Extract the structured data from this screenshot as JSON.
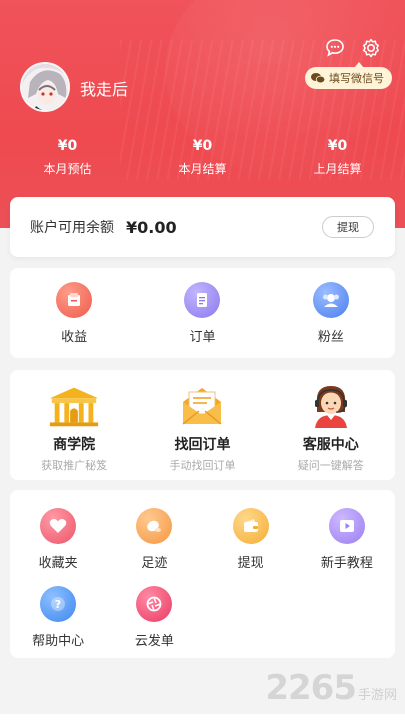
{
  "header": {
    "settings_chip": "填写微信号",
    "nickname": "我走后",
    "stats": [
      {
        "value": "¥0",
        "label": "本月预估"
      },
      {
        "value": "¥0",
        "label": "本月结算"
      },
      {
        "value": "¥0",
        "label": "上月结算"
      }
    ]
  },
  "balance": {
    "label": "账户可用余额",
    "amount": "¥0.00",
    "button": "提现"
  },
  "quick": [
    {
      "label": "收益",
      "icon": "income-icon",
      "color": "#f26b57"
    },
    {
      "label": "订单",
      "icon": "order-icon",
      "color": "#9a87f0"
    },
    {
      "label": "粉丝",
      "icon": "fans-icon",
      "color": "#5a8df5"
    }
  ],
  "features": [
    {
      "title": "商学院",
      "sub": "获取推广秘笈",
      "icon": "academy-icon"
    },
    {
      "title": "找回订单",
      "sub": "手动找回订单",
      "icon": "mail-icon"
    },
    {
      "title": "客服中心",
      "sub": "疑问一键解答",
      "icon": "support-agent-icon"
    }
  ],
  "tools": [
    {
      "label": "收藏夹",
      "icon": "heart-icon",
      "color": "#f06572"
    },
    {
      "label": "足迹",
      "icon": "footprint-icon",
      "color": "#f8a35a"
    },
    {
      "label": "提现",
      "icon": "wallet-icon",
      "color": "#f7bb4c"
    },
    {
      "label": "新手教程",
      "icon": "play-icon",
      "color": "#a98bf2"
    },
    {
      "label": "帮助中心",
      "icon": "help-icon",
      "color": "#4d98f3"
    },
    {
      "label": "云发单",
      "icon": "shutter-icon",
      "color": "#f0496c"
    }
  ],
  "watermark": {
    "number": "2265",
    "text": "手游网"
  }
}
